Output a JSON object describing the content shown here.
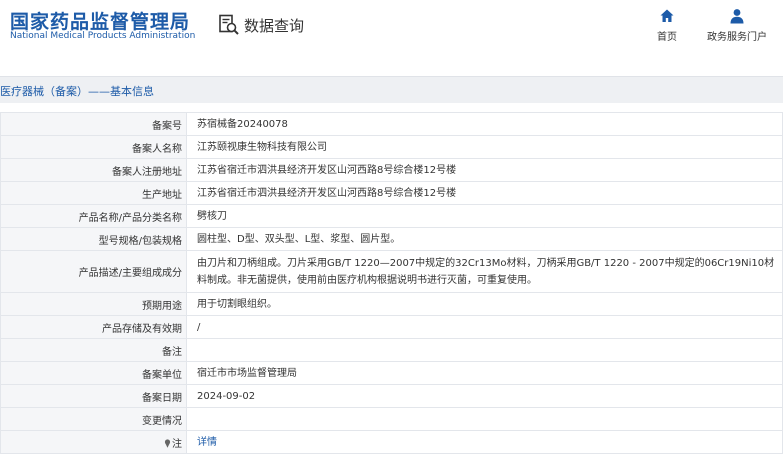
{
  "header": {
    "logo_cn": "国家药品监督管理局",
    "logo_en": "National Medical Products Administration",
    "query_title": "数据查询",
    "nav": [
      {
        "label": "首页",
        "icon": "home-icon"
      },
      {
        "label": "政务服务门户",
        "icon": "user-icon"
      }
    ]
  },
  "section": {
    "title": "医疗器械（备案）——基本信息"
  },
  "colors": {
    "brand_blue": "#1d5ba8",
    "label_bg": "#f5f6f8",
    "border": "#e3e6eb"
  },
  "rows": [
    {
      "label": "备案号",
      "value": "苏宿械备20240078"
    },
    {
      "label": "备案人名称",
      "value": "江苏颐视康生物科技有限公司"
    },
    {
      "label": "备案人注册地址",
      "value": "江苏省宿迁市泗洪县经济开发区山河西路8号综合楼12号楼"
    },
    {
      "label": "生产地址",
      "value": "江苏省宿迁市泗洪县经济开发区山河西路8号综合楼12号楼"
    },
    {
      "label": "产品名称/产品分类名称",
      "value": "劈核刀"
    },
    {
      "label": "型号规格/包装规格",
      "value": "圆柱型、D型、双头型、L型、浆型、圆片型。"
    },
    {
      "label": "产品描述/主要组成成分",
      "value": "由刀片和刀柄组成。刀片采用GB/T 1220—2007中规定的32Cr13Mo材料，刀柄采用GB/T 1220 - 2007中规定的06Cr19Ni10材料制成。非无菌提供，使用前由医疗机构根据说明书进行灭菌，可重复使用。"
    },
    {
      "label": "预期用途",
      "value": "用于切割眼组织。"
    },
    {
      "label": "产品存储及有效期",
      "value": "/"
    },
    {
      "label": "备注",
      "value": ""
    },
    {
      "label": "备案单位",
      "value": "宿迁市市场监督管理局"
    },
    {
      "label": "备案日期",
      "value": "2024-09-02"
    },
    {
      "label": "变更情况",
      "value": ""
    },
    {
      "label": "注",
      "value": "详情"
    }
  ]
}
